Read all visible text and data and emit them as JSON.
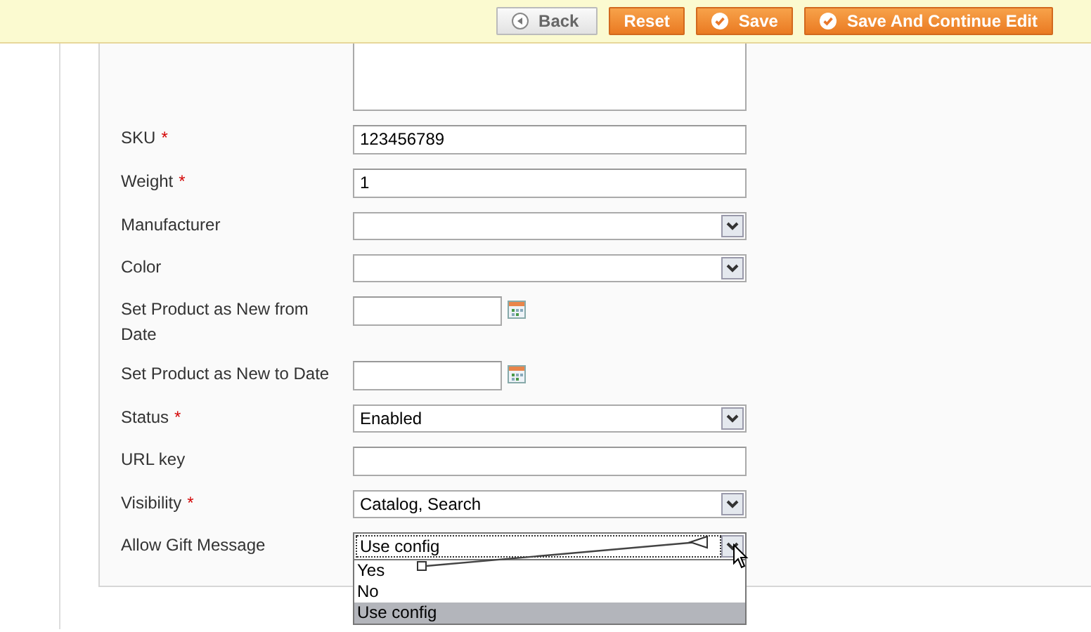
{
  "header_buttons": [
    {
      "label": "Back",
      "kind": "back"
    },
    {
      "label": "Reset",
      "kind": "plain"
    },
    {
      "label": "Save",
      "kind": "check"
    },
    {
      "label": "Save And Continue Edit",
      "kind": "check"
    }
  ],
  "fields": [
    {
      "kind": "textarea"
    },
    {
      "kind": "text",
      "label": "SKU",
      "value": "123456789",
      "mark": "*"
    },
    {
      "kind": "text",
      "label": "Weight",
      "value": "1",
      "mark": "*"
    },
    {
      "kind": "select",
      "label": "Manufacturer"
    },
    {
      "kind": "select",
      "label": "Color"
    },
    {
      "kind": "date",
      "label": "Set Product as New from Date"
    },
    {
      "kind": "date",
      "label": "Set Product as New to Date"
    },
    {
      "kind": "select",
      "label": "Status",
      "value": "Enabled",
      "mark": "*"
    },
    {
      "kind": "text",
      "label": "URL key"
    },
    {
      "kind": "select",
      "label": "Visibility",
      "value": "Catalog, Search",
      "mark": "*"
    },
    {
      "kind": "open-select",
      "label": "Allow Gift Message",
      "value": "Use config",
      "options": [
        {
          "label": "Yes",
          "selected": false
        },
        {
          "label": "No",
          "selected": false
        },
        {
          "label": "Use config",
          "selected": true
        }
      ]
    }
  ]
}
